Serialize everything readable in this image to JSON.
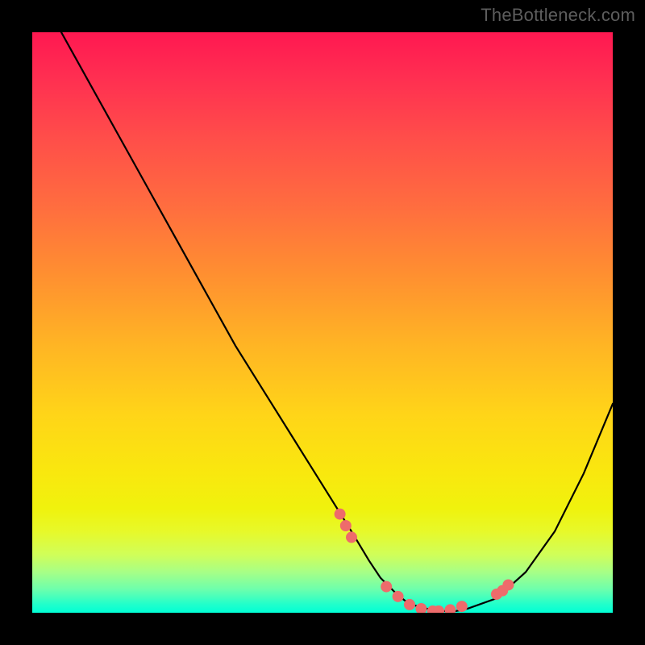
{
  "watermark": "TheBottleneck.com",
  "chart_data": {
    "type": "line",
    "title": "",
    "xlabel": "",
    "ylabel": "",
    "xlim": [
      0,
      100
    ],
    "ylim": [
      0,
      100
    ],
    "curve": {
      "x": [
        5,
        10,
        15,
        20,
        25,
        30,
        35,
        40,
        45,
        50,
        55,
        58,
        60,
        63,
        65,
        68,
        70,
        73,
        75,
        80,
        85,
        90,
        95,
        100
      ],
      "y": [
        100,
        91,
        82,
        73,
        64,
        55,
        46,
        38,
        30,
        22,
        14,
        9,
        6,
        3,
        1.5,
        0.7,
        0.3,
        0.3,
        0.7,
        2.5,
        7,
        14,
        24,
        36
      ]
    },
    "markers": {
      "x": [
        53,
        54,
        55,
        61,
        63,
        65,
        67,
        69,
        70,
        72,
        74,
        80,
        81,
        82
      ],
      "y": [
        17,
        15,
        13,
        4.5,
        2.8,
        1.4,
        0.7,
        0.3,
        0.3,
        0.5,
        1.1,
        3.2,
        3.8,
        4.8
      ]
    },
    "gradient_stops": [
      {
        "pos": 0,
        "color": "#ff1851"
      },
      {
        "pos": 0.5,
        "color": "#ffd518"
      },
      {
        "pos": 0.86,
        "color": "#e7f92a"
      },
      {
        "pos": 1.0,
        "color": "#00ffd6"
      }
    ]
  }
}
